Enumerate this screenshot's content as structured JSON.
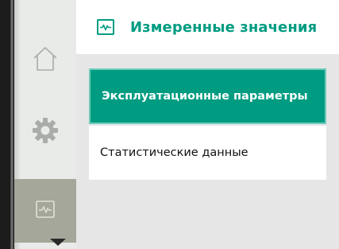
{
  "header": {
    "title": "Измеренные значения",
    "icon": "measurement-chart-icon"
  },
  "sidebar": {
    "items": [
      {
        "name": "home",
        "icon": "home-icon"
      },
      {
        "name": "settings",
        "icon": "gear-icon"
      },
      {
        "name": "measurement",
        "icon": "measurement-chart-icon",
        "selected": true
      }
    ],
    "scroll_indicator": "chevron-down-icon"
  },
  "menu": {
    "items": [
      {
        "label": "Эксплуатационные параметры",
        "selected": true
      },
      {
        "label": "Статистические данные",
        "selected": false
      }
    ]
  },
  "colors": {
    "accent": "#009c82",
    "sidebar_bg": "#e9ebe9",
    "sidebar_selected": "#a4a79a",
    "content_bg": "#e6e6e6"
  }
}
